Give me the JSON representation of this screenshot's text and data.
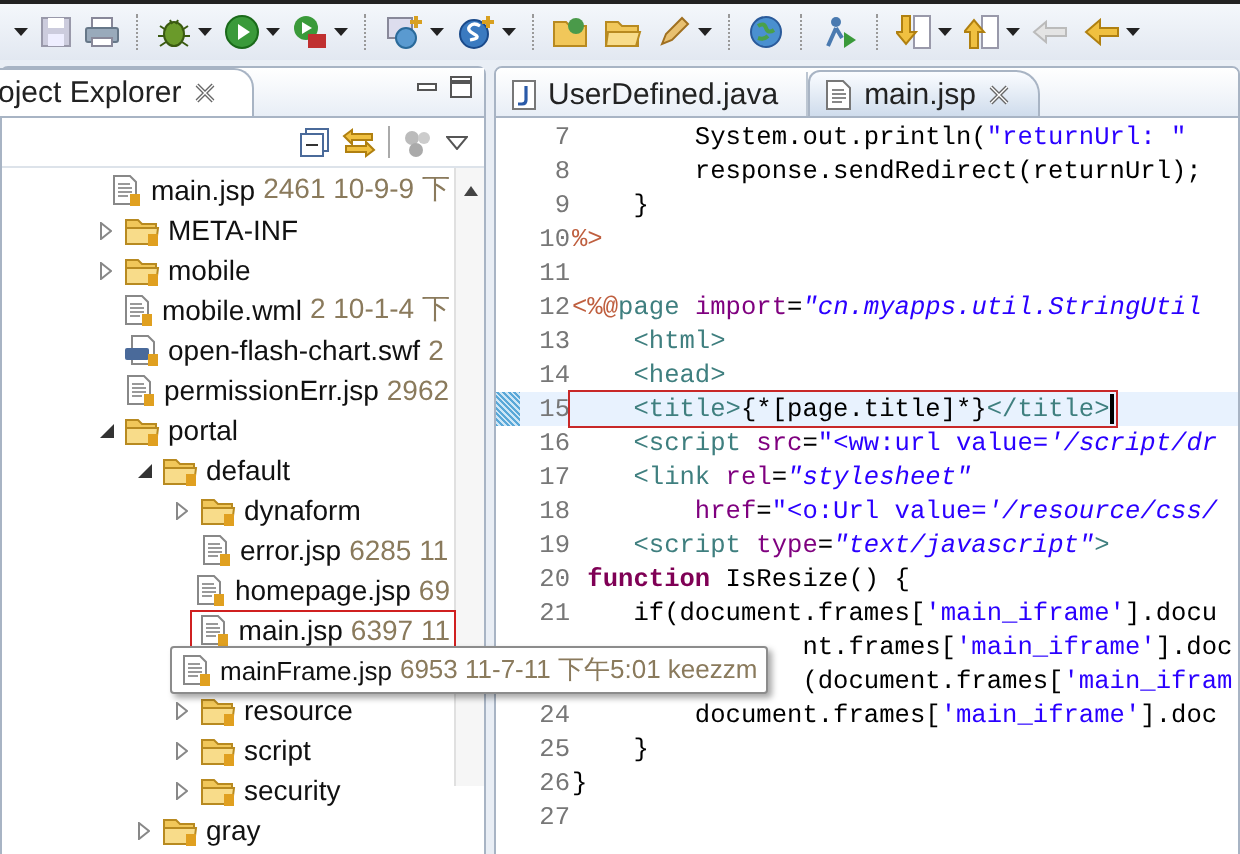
{
  "explorer": {
    "tab": {
      "label": "oject Explorer"
    },
    "tree": [
      {
        "name": "main.jsp",
        "detail": "2461  10-9-9 下",
        "kind": "file",
        "marked": false,
        "hover": false
      },
      {
        "name": "META-INF",
        "kind": "folder",
        "expanded": false,
        "marked": false,
        "hover": false
      },
      {
        "name": "mobile",
        "kind": "folder",
        "expanded": false,
        "marked": false,
        "hover": false
      },
      {
        "name": "mobile.wml",
        "detail": "2  10-1-4 下",
        "kind": "file",
        "marked": false,
        "hover": false
      },
      {
        "name": "open-flash-chart.swf",
        "detail": "2",
        "kind": "swf",
        "marked": false,
        "hover": false
      },
      {
        "name": "permissionErr.jsp",
        "detail": "2962",
        "kind": "file",
        "marked": false,
        "hover": false
      },
      {
        "name": "portal",
        "kind": "folder",
        "expanded": true,
        "marked": false,
        "hover": false,
        "children": [
          {
            "name": "default",
            "kind": "folder",
            "expanded": true,
            "marked": false,
            "hover": false,
            "children": [
              {
                "name": "dynaform",
                "kind": "folder",
                "expanded": false,
                "marked": false,
                "hover": false
              },
              {
                "name": "error.jsp",
                "detail": "6285  11",
                "kind": "file",
                "marked": false,
                "hover": false
              },
              {
                "name": "homepage.jsp",
                "detail": "69",
                "kind": "file",
                "marked": false,
                "hover": false
              },
              {
                "name": "main.jsp",
                "detail": "6397  11",
                "kind": "file",
                "marked": true,
                "hover": false
              },
              {
                "name": "mainFrame.jsp",
                "detail": "6953  11-7-11 下午5:01  keezzm",
                "kind": "file",
                "marked": false,
                "hover": true
              },
              {
                "name": "resource",
                "kind": "folder",
                "expanded": false,
                "marked": false,
                "hover": false
              },
              {
                "name": "script",
                "kind": "folder",
                "expanded": false,
                "marked": false,
                "hover": false
              },
              {
                "name": "security",
                "kind": "folder",
                "expanded": false,
                "marked": false,
                "hover": false
              }
            ]
          },
          {
            "name": "gray",
            "kind": "folder",
            "expanded": false,
            "marked": false,
            "hover": false
          }
        ]
      }
    ]
  },
  "editor": {
    "tabs": [
      {
        "label": "UserDefined.java",
        "kind": "java",
        "selected": false
      },
      {
        "label": "main.jsp",
        "kind": "jsp",
        "selected": true
      }
    ],
    "lines": [
      {
        "number": "7",
        "current": false,
        "marked": false,
        "code": [
          {
            "kind": "plain",
            "text": "        System.out.println("
          },
          {
            "kind": "string",
            "text": "\"returnUrl: \""
          }
        ]
      },
      {
        "number": "8",
        "current": false,
        "marked": false,
        "code": [
          {
            "kind": "plain",
            "text": "        response.sendRedirect(returnUrl);"
          }
        ]
      },
      {
        "number": "9",
        "current": false,
        "marked": false,
        "code": [
          {
            "kind": "plain",
            "text": "    }"
          }
        ]
      },
      {
        "number": "10",
        "current": false,
        "marked": false,
        "code": [
          {
            "kind": "jsp",
            "text": "%>"
          }
        ]
      },
      {
        "number": "11",
        "current": false
      },
      {
        "number": "12",
        "current": false,
        "marked": false,
        "code": [
          {
            "kind": "jsp",
            "text": "<%@"
          },
          {
            "kind": "tag",
            "text": "page "
          },
          {
            "kind": "attr",
            "text": "import"
          },
          {
            "kind": "plain",
            "text": "="
          },
          {
            "kind": "value",
            "text": "\"cn.myapps.util.StringUtil"
          }
        ]
      },
      {
        "number": "13",
        "current": false,
        "marked": false,
        "code": [
          {
            "kind": "tag",
            "text": "    <html>"
          }
        ]
      },
      {
        "number": "14",
        "current": false,
        "marked": false,
        "code": [
          {
            "kind": "tag",
            "text": "    <head>"
          }
        ]
      },
      {
        "number": "15",
        "current": true,
        "marked": true,
        "code": [
          {
            "kind": "tag",
            "text": "    <title>"
          },
          {
            "kind": "plain",
            "text": "{*[page.title]*}"
          },
          {
            "kind": "tag",
            "text": "</title>"
          }
        ]
      },
      {
        "number": "16",
        "current": false,
        "marked": false,
        "code": [
          {
            "kind": "tag",
            "text": "    <script "
          },
          {
            "kind": "attr",
            "text": "src"
          },
          {
            "kind": "plain",
            "text": "="
          },
          {
            "kind": "string",
            "text": "\"<ww:url value="
          },
          {
            "kind": "value",
            "text": "'/script/dr"
          }
        ]
      },
      {
        "number": "17",
        "current": false,
        "marked": false,
        "code": [
          {
            "kind": "tag",
            "text": "    <link "
          },
          {
            "kind": "attr",
            "text": "rel"
          },
          {
            "kind": "plain",
            "text": "="
          },
          {
            "kind": "value",
            "text": "\"stylesheet\""
          }
        ]
      },
      {
        "number": "18",
        "current": false,
        "marked": false,
        "code": [
          {
            "kind": "attr",
            "text": "        href"
          },
          {
            "kind": "plain",
            "text": "="
          },
          {
            "kind": "string",
            "text": "\"<o:Url value="
          },
          {
            "kind": "value",
            "text": "'/resource/css/"
          }
        ]
      },
      {
        "number": "19",
        "current": false,
        "marked": false,
        "code": [
          {
            "kind": "tag",
            "text": "    <script "
          },
          {
            "kind": "attr",
            "text": "type"
          },
          {
            "kind": "plain",
            "text": "="
          },
          {
            "kind": "value",
            "text": "\"text/javascript\""
          },
          {
            "kind": "tag",
            "text": ">"
          }
        ]
      },
      {
        "number": "20",
        "current": false,
        "marked": false,
        "code": [
          {
            "kind": "keyword",
            "text": " function"
          },
          {
            "kind": "plain",
            "text": " IsResize() {"
          }
        ]
      },
      {
        "number": "21",
        "current": false,
        "marked": false,
        "code": [
          {
            "kind": "plain",
            "text": "    if(document.frames["
          },
          {
            "kind": "string",
            "text": "'main_iframe'"
          },
          {
            "kind": "plain",
            "text": "].docu"
          }
        ]
      },
      {
        "current": false,
        "marked": false,
        "covered": true,
        "code": [
          {
            "kind": "plain",
            "text": "nt.frames["
          },
          {
            "kind": "string",
            "text": "'main_iframe'"
          },
          {
            "kind": "plain",
            "text": "].doc"
          }
        ]
      },
      {
        "current": false,
        "marked": false,
        "covered": true,
        "code": [
          {
            "kind": "plain",
            "text": "(document.frames["
          },
          {
            "kind": "string",
            "text": "'main_ifram"
          }
        ]
      },
      {
        "number": "24",
        "current": false,
        "marked": false,
        "code": [
          {
            "kind": "plain",
            "text": "        document.frames["
          },
          {
            "kind": "string",
            "text": "'main_iframe'"
          },
          {
            "kind": "plain",
            "text": "].doc"
          }
        ]
      },
      {
        "number": "25",
        "current": false,
        "marked": false,
        "code": [
          {
            "kind": "plain",
            "text": "    }"
          }
        ]
      },
      {
        "number": "26",
        "current": false,
        "marked": false,
        "code": [
          {
            "kind": "plain",
            "text": "}"
          }
        ]
      },
      {
        "number": "27",
        "current": false
      }
    ]
  }
}
